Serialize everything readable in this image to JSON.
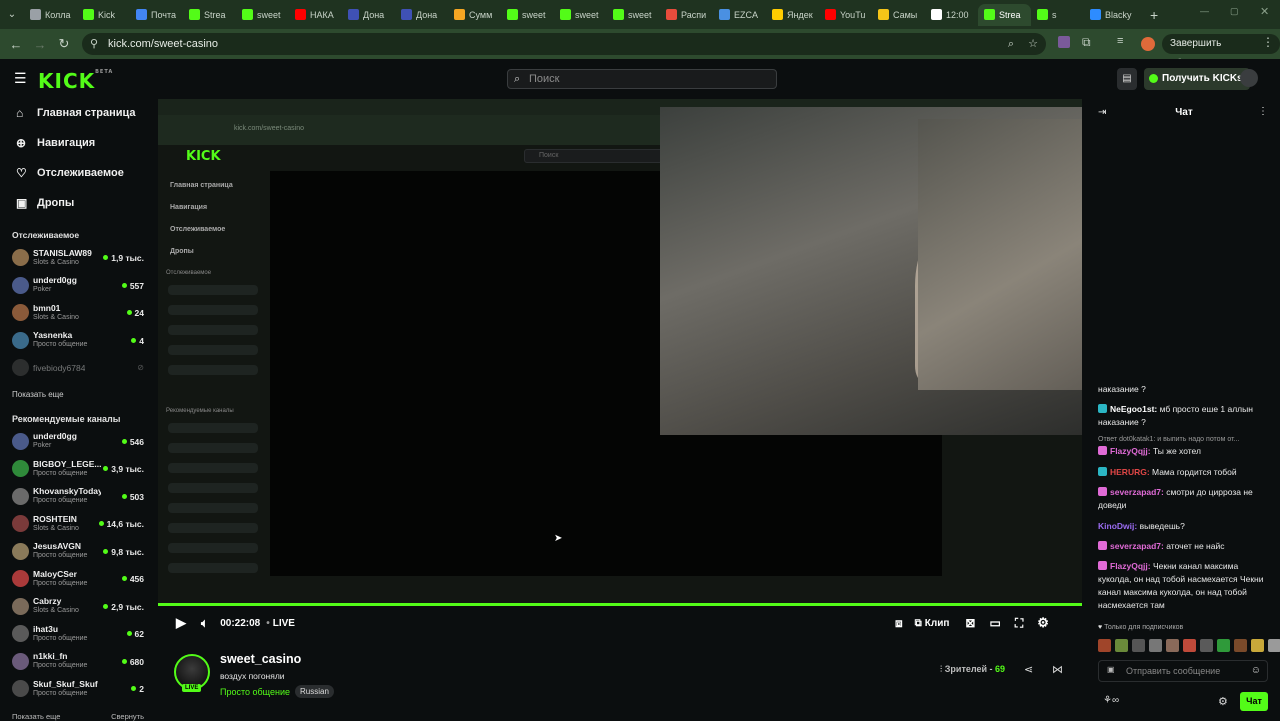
{
  "browser": {
    "tabs": [
      {
        "label": "Колла",
        "color": "#9aa0a6"
      },
      {
        "label": "Kick",
        "color": "#53fc18"
      },
      {
        "label": "Почта",
        "color": "#4285f4"
      },
      {
        "label": "Strea",
        "color": "#53fc18"
      },
      {
        "label": "sweet",
        "color": "#53fc18"
      },
      {
        "label": "НАКА",
        "color": "#ff0000"
      },
      {
        "label": "Дона",
        "color": "#3f51b5"
      },
      {
        "label": "Дона",
        "color": "#3f51b5"
      },
      {
        "label": "Сумм",
        "color": "#f5a623"
      },
      {
        "label": "sweet",
        "color": "#53fc18"
      },
      {
        "label": "sweet",
        "color": "#53fc18"
      },
      {
        "label": "sweet",
        "color": "#53fc18"
      },
      {
        "label": "Распи",
        "color": "#e74c3c"
      },
      {
        "label": "EZCA",
        "color": "#4a90e2"
      },
      {
        "label": "Яндек",
        "color": "#ffcc00"
      },
      {
        "label": "YouTu",
        "color": "#ff0000"
      },
      {
        "label": "Самы",
        "color": "#f5c518"
      },
      {
        "label": "12:00",
        "color": "#ffffff"
      },
      {
        "label": "Strea",
        "color": "#53fc18",
        "active": true
      },
      {
        "label": "s",
        "color": "#53fc18"
      },
      {
        "label": "Blacky",
        "color": "#2d8cff"
      }
    ],
    "url": "kick.com/sweet-casino",
    "update_label": "Завершить обновление"
  },
  "header": {
    "logo": "KICK",
    "logo_badge": "BETA",
    "search_placeholder": "Поиск",
    "get_kicks": "Получить KICKs"
  },
  "sidebar": {
    "nav": [
      {
        "label": "Главная страница",
        "icon": "home-icon"
      },
      {
        "label": "Навигация",
        "icon": "compass-icon"
      },
      {
        "label": "Отслеживаемое",
        "icon": "heart-icon"
      },
      {
        "label": "Дропы",
        "icon": "gift-icon"
      }
    ],
    "following_title": "Отслеживаемое",
    "following": [
      {
        "name": "STANISLAW89",
        "category": "Slots & Casino",
        "viewers": "1,9 тыс.",
        "color": "#8a6d4a"
      },
      {
        "name": "underd0gg",
        "category": "Poker",
        "viewers": "557",
        "color": "#4a5a8a"
      },
      {
        "name": "bmn01",
        "category": "Slots & Casino",
        "viewers": "24",
        "color": "#8a5a3a"
      },
      {
        "name": "Yasnenka",
        "category": "Просто общение",
        "viewers": "4",
        "color": "#3a6a8a"
      }
    ],
    "offline": {
      "name": "fivebiody6784",
      "color": "#555555"
    },
    "show_more": "Показать еще",
    "recommended_title": "Рекомендуемые каналы",
    "recommended": [
      {
        "name": "underd0gg",
        "category": "Poker",
        "viewers": "546",
        "color": "#4a5a8a"
      },
      {
        "name": "BIGBOY_LEGE...",
        "category": "Просто общение",
        "viewers": "3,9 тыс.",
        "color": "#2f8a3a"
      },
      {
        "name": "KhovanskyToday",
        "category": "Просто общение",
        "viewers": "503",
        "color": "#6a6a6a"
      },
      {
        "name": "ROSHTEIN",
        "category": "Slots & Casino",
        "viewers": "14,6 тыс.",
        "color": "#7a3a3a"
      },
      {
        "name": "JesusAVGN",
        "category": "Просто общение",
        "viewers": "9,8 тыс.",
        "color": "#8a7a5a"
      },
      {
        "name": "MaloyCSer",
        "category": "Просто общение",
        "viewers": "456",
        "color": "#aa3a3a"
      },
      {
        "name": "Cabrzy",
        "category": "Slots & Casino",
        "viewers": "2,9 тыс.",
        "color": "#7a6a5a"
      },
      {
        "name": "ihat3u",
        "category": "Просто общение",
        "viewers": "62",
        "color": "#5a5a5a"
      },
      {
        "name": "n1kki_fn",
        "category": "Просто общение",
        "viewers": "680",
        "color": "#6a5a7a"
      },
      {
        "name": "Skuf_Skuf_Skuf",
        "category": "Просто общение",
        "viewers": "2",
        "color": "#4a4a4a"
      }
    ],
    "footer_left": "Показать еще",
    "footer_right": "Свернуть"
  },
  "player": {
    "time": "00:22:08",
    "live": "LIVE",
    "clip": "Клип"
  },
  "nested": {
    "url": "kick.com/sweet-casino",
    "search": "Поиск",
    "nav": [
      "Главная страница",
      "Навигация",
      "Отслеживаемое",
      "Дропы"
    ],
    "following": "Отслеживаемое",
    "recommended": "Рекомендуемые каналы"
  },
  "stream": {
    "name": "sweet_casino",
    "title": "воздух погоняли",
    "category": "Просто общение",
    "tag": "Russian",
    "viewers_label": "Зрителей -",
    "viewers": "69",
    "live_badge": "LIVE"
  },
  "chat": {
    "title": "Чат",
    "messages": [
      {
        "user": "",
        "text": "наказание ?",
        "color": "#eaeaea",
        "badge": ""
      },
      {
        "user": "NeEgoo1st:",
        "text": " мб просто еше 1 аллын наказание ?",
        "color": "#ffffff",
        "badge": "#2bb6c4"
      },
      {
        "user": "",
        "text": "Ответ dot0katak1: и выпить надо потом от...",
        "color": "#9a9a9a",
        "badge": ""
      },
      {
        "user": "FlazyQqjj:",
        "text": " Ты же хотел",
        "color": "#e06bd6",
        "badge": "#e06bd6"
      },
      {
        "user": "HERURG:",
        "text": " Мама гордится тобой",
        "color": "#e04646",
        "badge": "#2bb6c4"
      },
      {
        "user": "severzapad7:",
        "text": " смотри до цирроза не доведи",
        "color": "#e06bd6",
        "badge": "#e06bd6"
      },
      {
        "user": "KinoDwij:",
        "text": " выведешь?",
        "color": "#9b6cf2",
        "badge": ""
      },
      {
        "user": "severzapad7:",
        "text": " аточет не найс",
        "color": "#e06bd6",
        "badge": "#e06bd6"
      },
      {
        "user": "FlazyQqjj:",
        "text": " Чекни канал максима куколда, он над тобой насмехается Чекни канал максима куколда, он над тобой насмехается там",
        "color": "#e06bd6",
        "badge": "#e06bd6"
      }
    ],
    "subs_only": "Только для подписчиков",
    "input_placeholder": "Отправить сообщение",
    "send": "Чат"
  }
}
